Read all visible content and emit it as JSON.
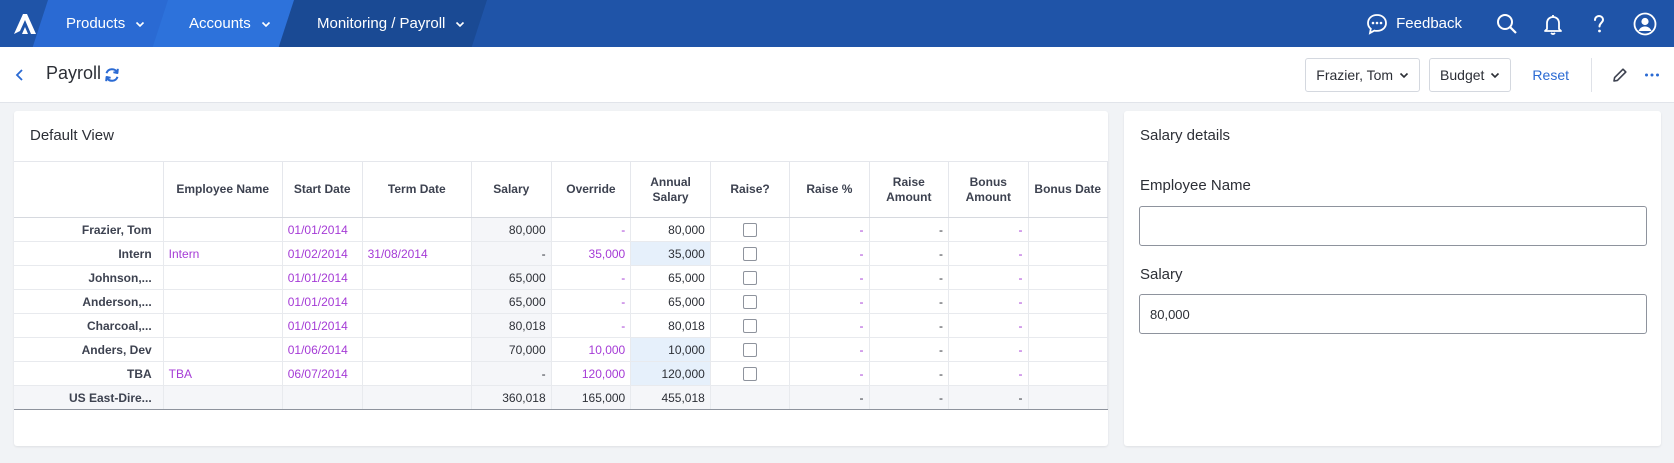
{
  "nav": {
    "products": "Products",
    "accounts": "Accounts",
    "monitoring": "Monitoring / Payroll",
    "feedback": "Feedback"
  },
  "subheader": {
    "title": "Payroll",
    "employee_select": "Frazier, Tom",
    "version_select": "Budget",
    "reset": "Reset"
  },
  "grid": {
    "title": "Default View",
    "columns": [
      "",
      "Employee Name",
      "Start Date",
      "Term Date",
      "Salary",
      "Override",
      "Annual Salary",
      "Raise?",
      "Raise %",
      "Raise Amount",
      "Bonus Amount",
      "Bonus Date"
    ],
    "rows": [
      {
        "label": "Frazier, Tom",
        "employee_name": "",
        "start_date": "01/01/2014",
        "term_date": "",
        "salary": "80,000",
        "override": "-",
        "annual_salary": "80,000",
        "raise_pct": "-",
        "raise_amount": "-",
        "bonus_amount": "-",
        "bonus_date": ""
      },
      {
        "label": "Intern",
        "employee_name": "Intern",
        "start_date": "01/02/2014",
        "term_date": "31/08/2014",
        "salary": "-",
        "override": "35,000",
        "annual_salary": "35,000",
        "raise_pct": "-",
        "raise_amount": "-",
        "bonus_amount": "-",
        "bonus_date": ""
      },
      {
        "label": "Johnson,...",
        "employee_name": "",
        "start_date": "01/01/2014",
        "term_date": "",
        "salary": "65,000",
        "override": "-",
        "annual_salary": "65,000",
        "raise_pct": "-",
        "raise_amount": "-",
        "bonus_amount": "-",
        "bonus_date": ""
      },
      {
        "label": "Anderson,...",
        "employee_name": "",
        "start_date": "01/01/2014",
        "term_date": "",
        "salary": "65,000",
        "override": "-",
        "annual_salary": "65,000",
        "raise_pct": "-",
        "raise_amount": "-",
        "bonus_amount": "-",
        "bonus_date": ""
      },
      {
        "label": "Charcoal,...",
        "employee_name": "",
        "start_date": "01/01/2014",
        "term_date": "",
        "salary": "80,018",
        "override": "-",
        "annual_salary": "80,018",
        "raise_pct": "-",
        "raise_amount": "-",
        "bonus_amount": "-",
        "bonus_date": ""
      },
      {
        "label": "Anders, Dev",
        "employee_name": "",
        "start_date": "01/06/2014",
        "term_date": "",
        "salary": "70,000",
        "override": "10,000",
        "annual_salary": "10,000",
        "raise_pct": "-",
        "raise_amount": "-",
        "bonus_amount": "-",
        "bonus_date": ""
      },
      {
        "label": "TBA",
        "employee_name": "TBA",
        "start_date": "06/07/2014",
        "term_date": "",
        "salary": "-",
        "override": "120,000",
        "annual_salary": "120,000",
        "raise_pct": "-",
        "raise_amount": "-",
        "bonus_amount": "-",
        "bonus_date": ""
      }
    ],
    "total": {
      "label": "US East-Dire...",
      "salary": "360,018",
      "override": "165,000",
      "annual_salary": "455,018",
      "raise_pct": "-",
      "raise_amount": "-",
      "bonus_amount": "-"
    }
  },
  "details": {
    "title": "Salary details",
    "employee_name_label": "Employee Name",
    "employee_name_value": "",
    "salary_label": "Salary",
    "salary_value": "80,000"
  },
  "colors": {
    "nav_bg": "#1f54a8",
    "accent": "#2a6ad3",
    "link_purple": "#a53bd6"
  }
}
